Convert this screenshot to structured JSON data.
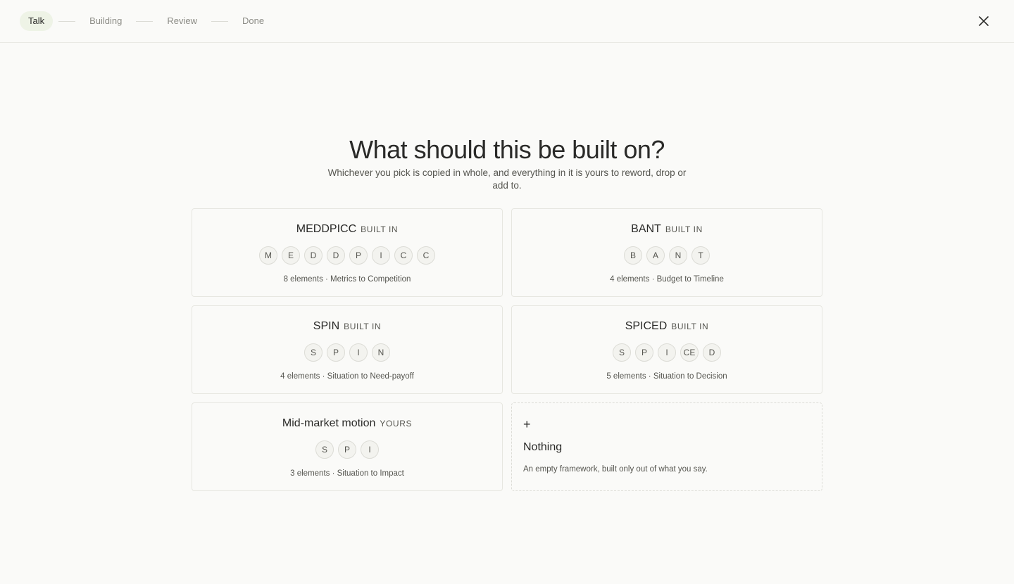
{
  "steps": [
    {
      "label": "Talk"
    },
    {
      "label": "Building"
    },
    {
      "label": "Review"
    },
    {
      "label": "Done"
    }
  ],
  "close_icon": "close-icon",
  "heading": "What should this be built on?",
  "subheading": "Whichever you pick is copied in whole, and everything in it is yours to reword, drop or add to.",
  "frameworks": [
    {
      "name": "MEDDPICC",
      "tag": "BUILT IN",
      "chips": [
        "M",
        "E",
        "D",
        "D",
        "P",
        "I",
        "C",
        "C"
      ],
      "meta": "8 elements · Metrics to Competition"
    },
    {
      "name": "BANT",
      "tag": "BUILT IN",
      "chips": [
        "B",
        "A",
        "N",
        "T"
      ],
      "meta": "4 elements · Budget to Timeline"
    },
    {
      "name": "SPIN",
      "tag": "BUILT IN",
      "chips": [
        "S",
        "P",
        "I",
        "N"
      ],
      "meta": "4 elements · Situation to Need-payoff"
    },
    {
      "name": "SPICED",
      "tag": "BUILT IN",
      "chips": [
        "S",
        "P",
        "I",
        "CE",
        "D"
      ],
      "meta": "5 elements · Situation to Decision"
    },
    {
      "name": "Mid-market motion",
      "tag": "YOURS",
      "chips": [
        "S",
        "P",
        "I"
      ],
      "meta": "3 elements · Situation to Impact"
    }
  ],
  "nothing": {
    "plus": "+",
    "title": "Nothing",
    "description": "An empty framework, built only out of what you say."
  }
}
